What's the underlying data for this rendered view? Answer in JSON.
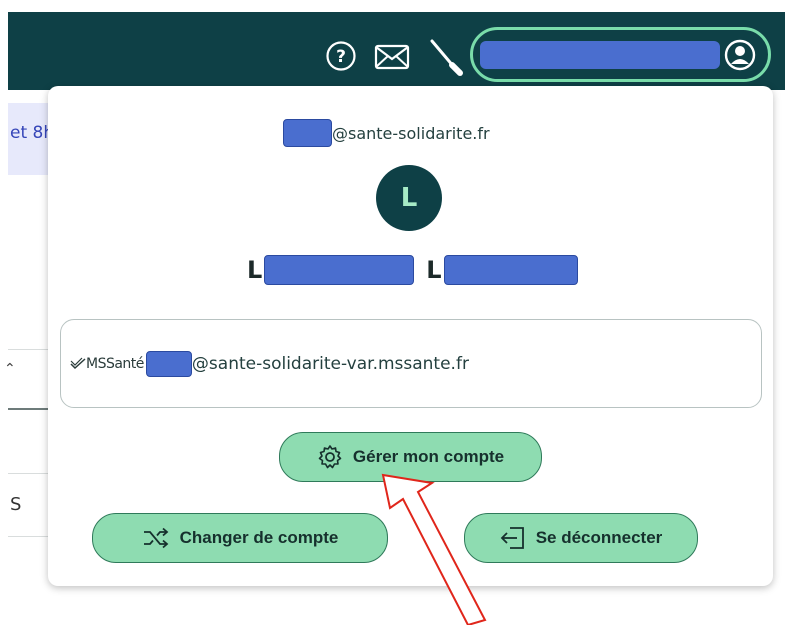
{
  "header": {
    "help_icon": "help-circle-icon",
    "mail_icon": "mail-icon",
    "tool_icon": "tool-icon",
    "account_icon": "user-circle-icon"
  },
  "background_page": {
    "strip_text": "et 8h",
    "list_item_text": "S"
  },
  "popup": {
    "email_suffix": "@sante-solidarite.fr",
    "avatar_initial": "L",
    "name_first_initial": "L",
    "name_last_initial": "L",
    "mss_logo": "MSSanté",
    "mss_email_suffix": "@sante-solidarite-var.mssante.fr",
    "manage_account_label": "Gérer mon compte",
    "switch_account_label": "Changer de compte",
    "logout_label": "Se déconnecter"
  },
  "colors": {
    "topbar": "#0e4046",
    "button_fill": "#8edcb1",
    "button_border": "#2f7a5a",
    "redaction": "#4a6ecf",
    "annotation_arrow": "#e0261b"
  }
}
